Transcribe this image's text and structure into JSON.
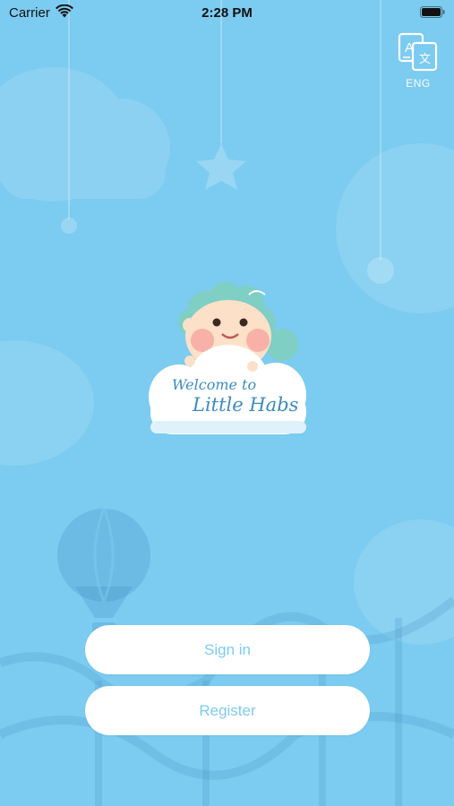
{
  "status_bar": {
    "carrier": "Carrier",
    "time": "2:28 PM"
  },
  "language": {
    "label": "ENG",
    "icon": "translate-icon"
  },
  "logo": {
    "line1": "Welcome to",
    "line2": "Little Habs"
  },
  "buttons": {
    "sign_in": "Sign in",
    "register": "Register"
  },
  "colors": {
    "background": "#7ccbf0",
    "button_bg": "#ffffff",
    "button_text": "#7ccbf0",
    "logo_text": "#3d8bc0"
  }
}
